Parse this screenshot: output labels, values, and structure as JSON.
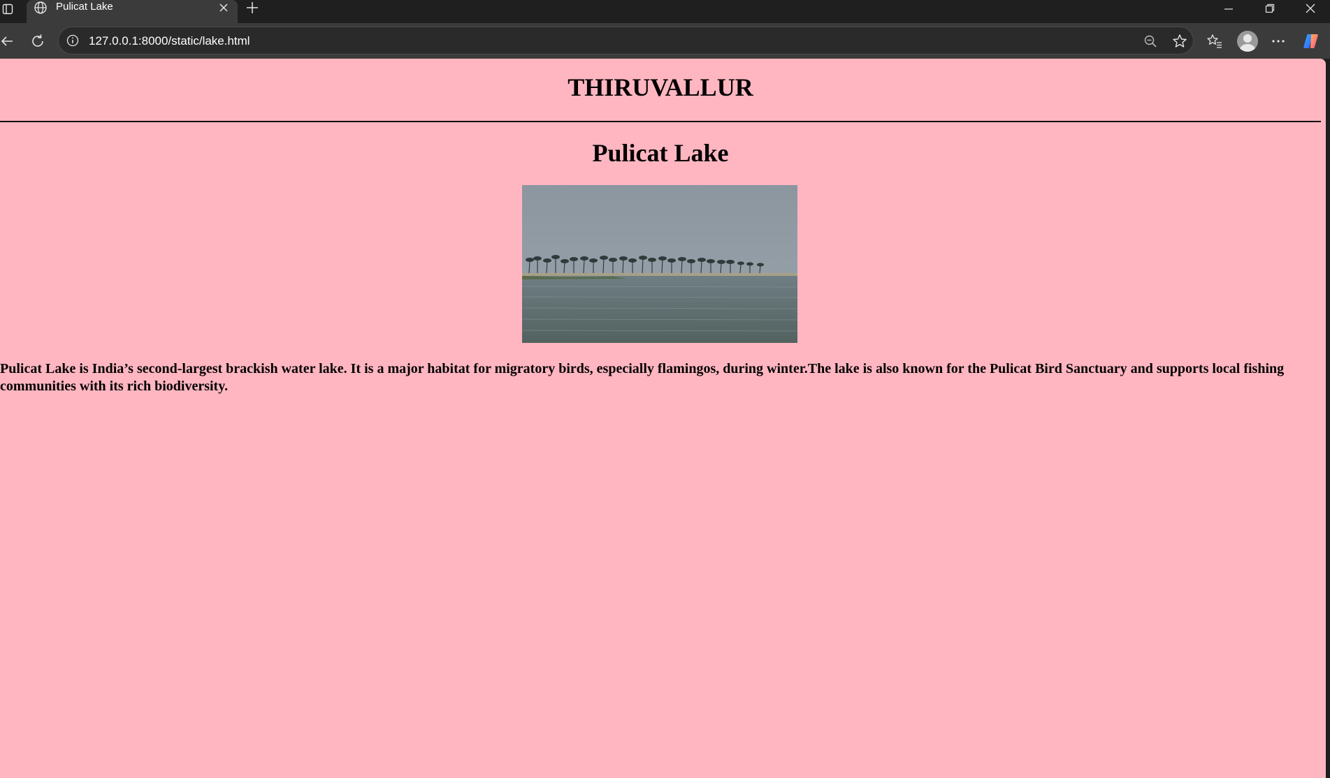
{
  "browser": {
    "tab_title": "Pulicat Lake",
    "url": "127.0.0.1:8000/static/lake.html",
    "icons": {
      "sidebar": "sidebar-toggle-icon",
      "tab": "globe-icon",
      "close_tab": "close-icon",
      "new_tab": "plus-icon",
      "minimize": "minimize-icon",
      "restore": "restore-icon",
      "close_window": "close-icon",
      "back": "back-arrow-icon",
      "reload": "reload-icon",
      "site_info": "info-icon",
      "zoom": "zoom-out-icon",
      "favorite": "star-icon",
      "favorites": "favorites-list-icon",
      "profile": "avatar",
      "menu": "more-icon",
      "copilot": "copilot-icon"
    }
  },
  "page": {
    "heading": "THIRUVALLUR",
    "title": "Pulicat Lake",
    "image_alt": "Pulicat Lake",
    "description": "Pulicat Lake is India’s second-largest brackish water lake. It is a major habitat for migratory birds, especially flamingos, during winter.The lake is also known for the Pulicat Bird Sanctuary and supports local fishing communities with its rich biodiversity."
  },
  "colors": {
    "page_background": "#ffb6c1",
    "browser_chrome": "#3b3b3b",
    "title_bar": "#1f1f1f"
  }
}
